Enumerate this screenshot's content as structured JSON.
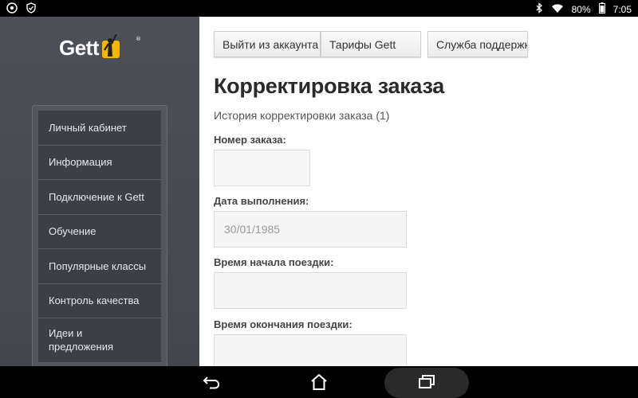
{
  "status_bar": {
    "battery": "80%",
    "time": "7:05",
    "icons": [
      "chrome-icon",
      "shield-icon",
      "bluetooth-icon",
      "wifi-icon",
      "battery-icon"
    ]
  },
  "sidebar": {
    "logo_text": "Gett",
    "logo_mark": "®",
    "menu": [
      {
        "label": "Личный кабинет"
      },
      {
        "label": "Информация"
      },
      {
        "label": "Подключение к Gett"
      },
      {
        "label": "Обучение"
      },
      {
        "label": "Популярные классы"
      },
      {
        "label": "Контроль качества"
      },
      {
        "label": "Идеи и предложения"
      }
    ]
  },
  "main": {
    "buttons": {
      "logout": "Выйти из аккаунта",
      "tariffs": "Тарифы Gett",
      "support": "Служба поддержки"
    },
    "title": "Корректировка заказа",
    "history": "История корректировки заказа (1)",
    "fields": {
      "order_number_label": "Номер заказа:",
      "order_number_value": "",
      "date_label": "Дата выполнения:",
      "date_value": "30/01/1985",
      "start_time_label": "Время начала поездки:",
      "start_time_value": "",
      "end_time_label": "Время окончания поездки:",
      "end_time_value": ""
    }
  },
  "colors": {
    "sidebar_bg": "#4e5058",
    "menu_item_bg": "#3d3f46",
    "logo_accent": "#f5b800"
  }
}
